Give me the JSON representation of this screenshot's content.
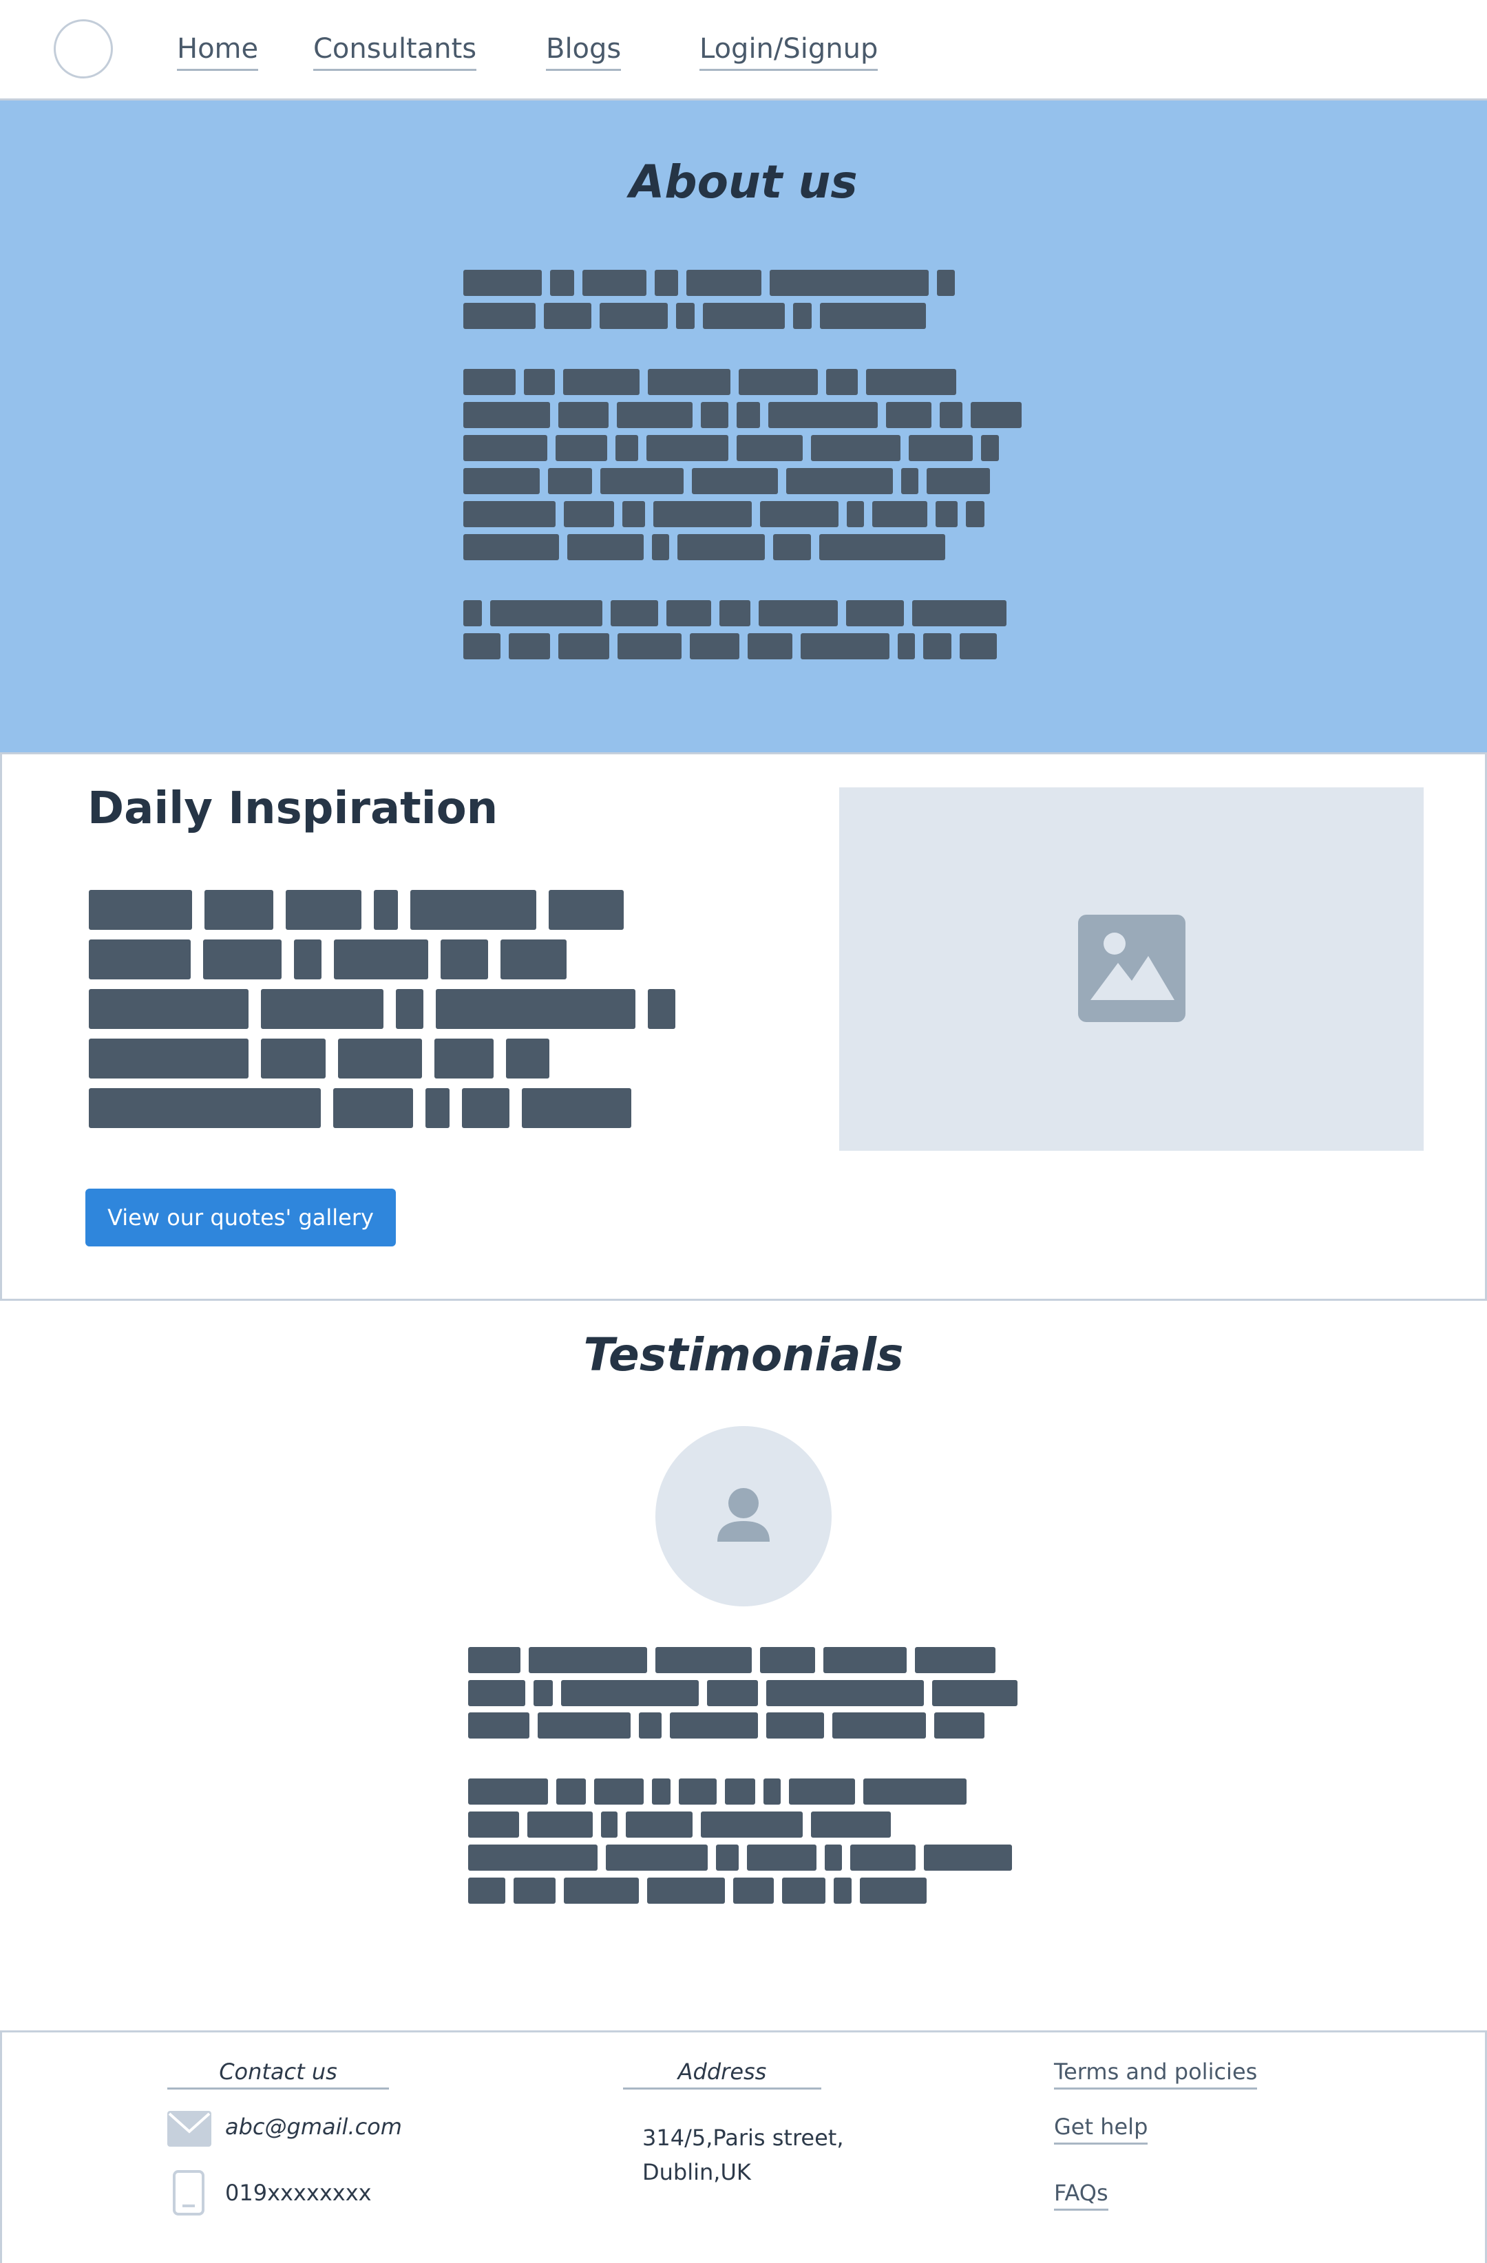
{
  "nav": {
    "links": [
      "Home",
      "Consultants",
      "Blogs",
      "Login/Signup"
    ]
  },
  "about": {
    "title": "About us"
  },
  "inspiration": {
    "title": "Daily Inspiration",
    "button_label": "View our quotes' gallery",
    "image_icon": "image-placeholder-icon"
  },
  "testimonials": {
    "title": "Testimonials",
    "avatar_icon": "user-avatar-icon"
  },
  "footer": {
    "contact": {
      "heading": "Contact us",
      "email": "abc@gmail.com",
      "phone": "019xxxxxxxx"
    },
    "address": {
      "heading": "Address",
      "line1": "314/5,Paris street,",
      "line2": "Dublin,UK"
    },
    "links": [
      "Terms and policies",
      "Get help",
      "FAQs"
    ]
  },
  "colors": {
    "about_bg": "#95c1ec",
    "button_bg": "#2f86dc",
    "placeholder_text": "#4b5a69"
  }
}
